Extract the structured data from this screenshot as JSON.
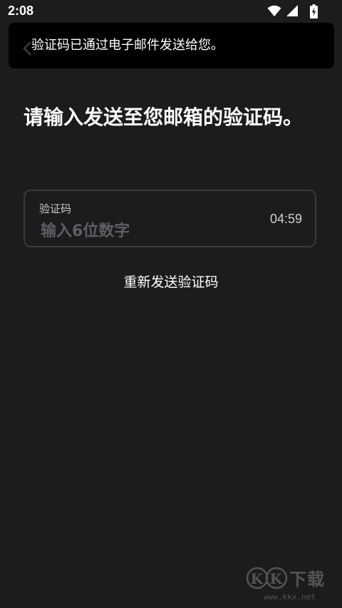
{
  "status_bar": {
    "time": "2:08",
    "icons": [
      "wifi-icon",
      "cellular-signal-icon",
      "battery-charging-icon"
    ]
  },
  "toast": {
    "message": "验证码已通过电子邮件发送给您。"
  },
  "page": {
    "title": "请输入发送至您邮箱的验证码。"
  },
  "code_field": {
    "label": "验证码",
    "placeholder": "输入6位数字",
    "countdown": "04:59"
  },
  "resend": {
    "label": "重新发送验证码"
  },
  "watermark": {
    "logo": "KK下载",
    "url": "www.kkx.net"
  },
  "colors": {
    "background": "#1c1c1e",
    "toast_background": "#000000",
    "field_border": "#3a3a3d",
    "placeholder": "#5e5e62"
  }
}
